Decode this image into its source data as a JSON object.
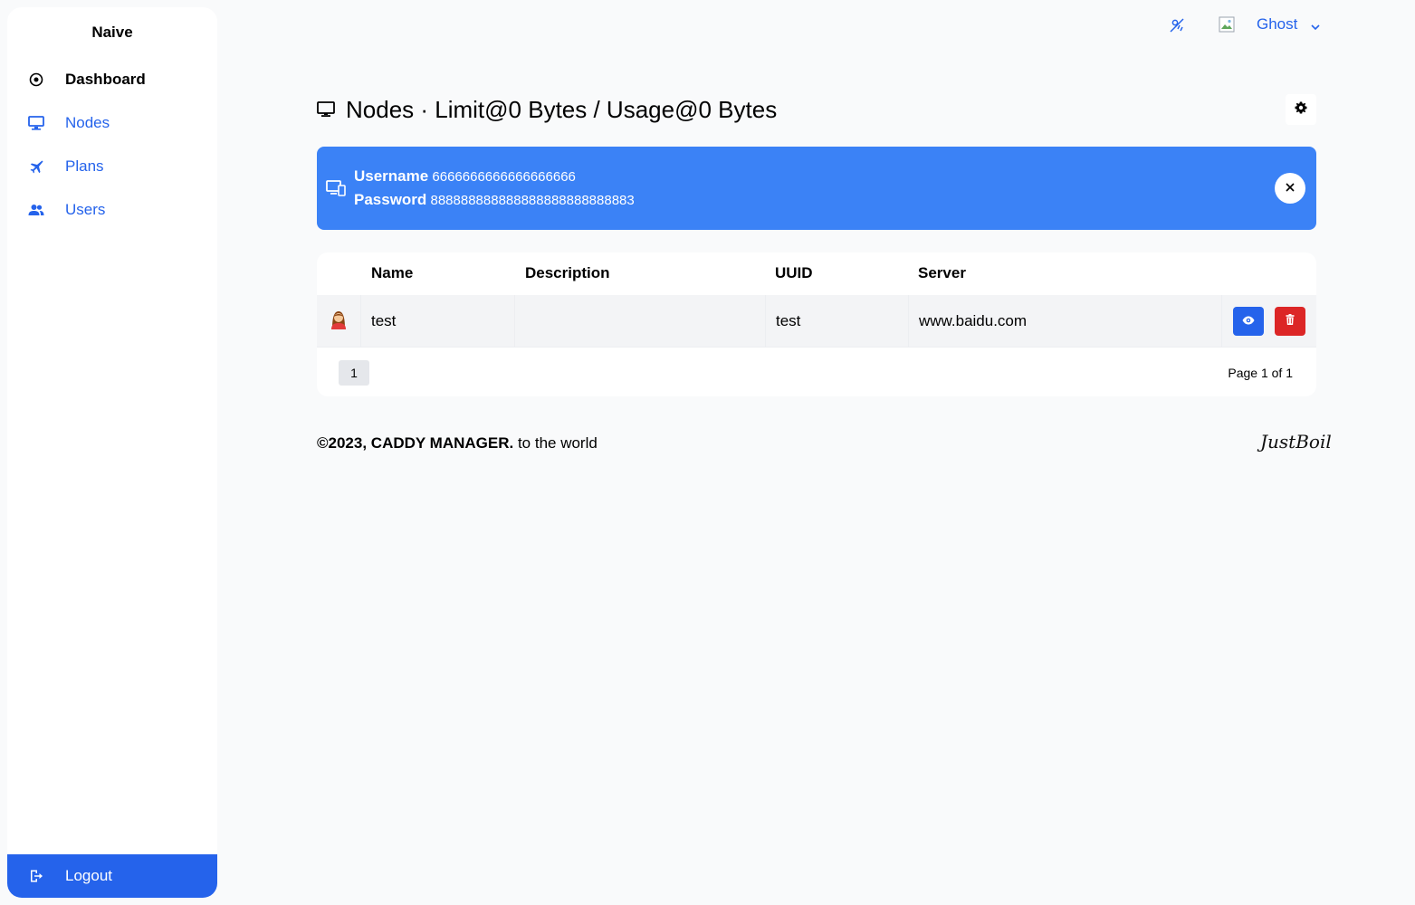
{
  "sidebar": {
    "brand": "Naive",
    "items": [
      {
        "label": "Dashboard",
        "icon": "target-icon"
      },
      {
        "label": "Nodes",
        "icon": "monitor-icon"
      },
      {
        "label": "Plans",
        "icon": "airplane-icon"
      },
      {
        "label": "Users",
        "icon": "users-icon"
      }
    ],
    "logout": {
      "label": "Logout",
      "icon": "logout-icon"
    }
  },
  "topbar": {
    "theme_icon": "weather-toggle-icon",
    "user_name": "Ghost"
  },
  "page": {
    "title": "Nodes · Limit@0 Bytes / Usage@0 Bytes"
  },
  "notice": {
    "username_label": "Username",
    "username_value": "6666666666666666666",
    "password_label": "Password",
    "password_value": "888888888888888888888888883"
  },
  "table": {
    "columns": [
      "Name",
      "Description",
      "UUID",
      "Server"
    ],
    "rows": [
      {
        "name": "test",
        "description": "",
        "uuid": "test",
        "server": "www.baidu.com"
      }
    ],
    "pager": {
      "current": "1",
      "info": "Page 1 of 1"
    }
  },
  "footer": {
    "copyright": "©2023, CADDY MANAGER.",
    "tagline": " to the world",
    "logo": "JustBoil"
  },
  "colors": {
    "accent": "#2563eb",
    "notice_bg": "#3b82f6",
    "danger": "#dc2626",
    "page_bg": "#f9fafb"
  }
}
